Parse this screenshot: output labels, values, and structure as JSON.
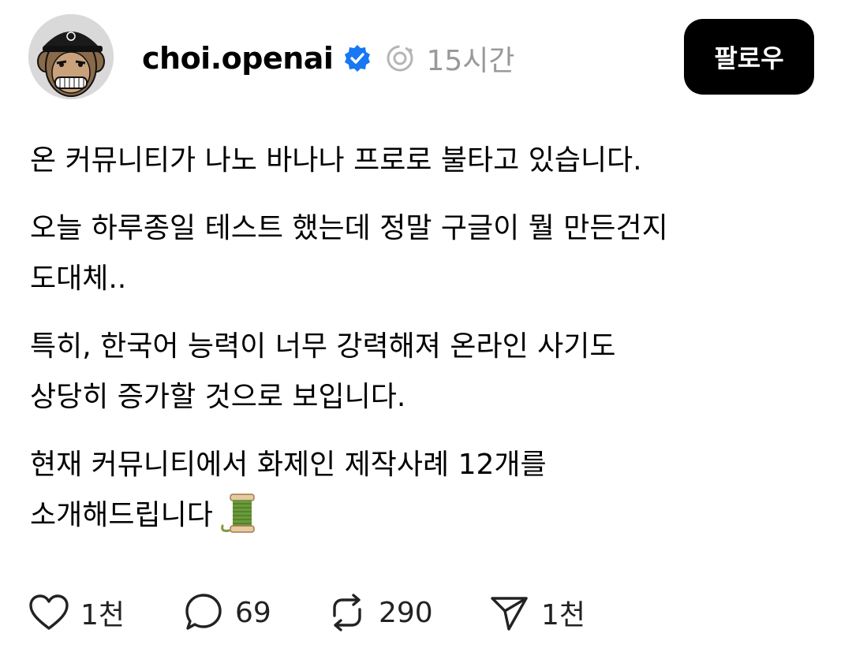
{
  "post": {
    "author": {
      "username": "choi.openai",
      "avatar_icon": "ape-avatar-icon",
      "verified_icon": "verified-badge-icon",
      "ai_label_icon": "ai-generated-icon"
    },
    "timestamp": "15시간",
    "follow_label": "팔로우",
    "paragraphs": [
      [
        "온 커뮤니티가 나노 바나나 프로로 불타고 있습니다."
      ],
      [
        "오늘 하루종일 테스트 했는데 정말 구글이 뭘 만든건지",
        "도대체.."
      ],
      [
        "특히, 한국어 능력이 너무 강력해져 온라인 사기도",
        "상당히 증가할 것으로 보입니다."
      ],
      [
        "현재 커뮤니티에서 화제인 제작사례 12개를",
        "소개해드립니다"
      ]
    ],
    "trailing_emoji": "thread-spool-emoji",
    "actions": {
      "likes": "1천",
      "comments": "69",
      "reposts": "290",
      "shares": "1천"
    }
  },
  "colors": {
    "verified_blue": "#1877F2",
    "timestamp_gray": "#999999",
    "button_black": "#000000"
  }
}
